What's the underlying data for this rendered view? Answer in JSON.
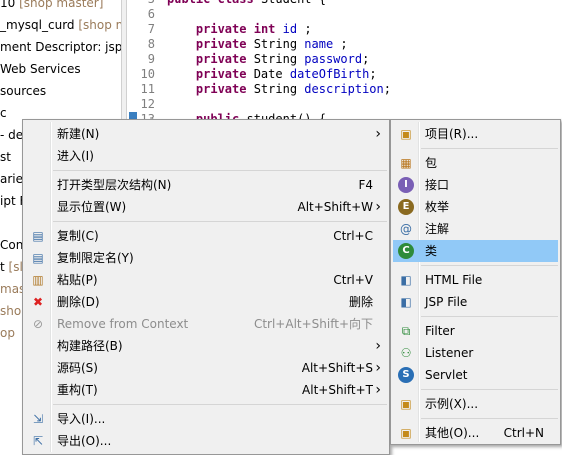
{
  "explorer": {
    "rows": [
      {
        "text": "10",
        "muted": " [shop master]"
      },
      {
        "text": "_mysql_curd",
        "muted": " [shop m"
      },
      {
        "text": "ment Descriptor: jsp_",
        "muted": ""
      },
      {
        "text": " Web Services",
        "muted": ""
      },
      {
        "text": "sources",
        "muted": ""
      },
      {
        "text": "c",
        "muted": ""
      },
      {
        "text": "- demo",
        "muted": ""
      },
      {
        "text": "st",
        "muted": ""
      },
      {
        "text": "aries",
        "muted": ""
      },
      {
        "text": "ipt F",
        "muted": ""
      },
      {
        "text": "",
        "muted": ""
      },
      {
        "text": "Cont",
        "muted": ""
      },
      {
        "text": "t",
        "muted": " [sl"
      },
      {
        "text": "",
        "muted": "mas"
      },
      {
        "text": "",
        "muted": "sho"
      },
      {
        "text": "",
        "muted": "op"
      }
    ]
  },
  "editor": {
    "lines": [
      {
        "n": "5",
        "code": "public class Student {"
      },
      {
        "n": "6",
        "code": ""
      },
      {
        "n": "7",
        "code": "    private int id ;"
      },
      {
        "n": "8",
        "code": "    private String name ;"
      },
      {
        "n": "9",
        "code": "    private String password;"
      },
      {
        "n": "10",
        "code": "    private Date dateOfBirth;"
      },
      {
        "n": "11",
        "code": "    private String description;"
      },
      {
        "n": "12",
        "code": ""
      },
      {
        "n": "13",
        "code": "    public student() {"
      }
    ]
  },
  "main_menu": {
    "items": [
      {
        "icon": "",
        "label": "新建(N)",
        "shortcut": "",
        "arrow": true
      },
      {
        "icon": "",
        "label": "进入(I)",
        "shortcut": ""
      },
      {
        "sep": true
      },
      {
        "icon": "",
        "label": "打开类型层次结构(N)",
        "shortcut": "F4"
      },
      {
        "icon": "",
        "label": "显示位置(W)",
        "shortcut": "Alt+Shift+W",
        "arrow": true
      },
      {
        "sep": true
      },
      {
        "icon": "copy-icon",
        "label": "复制(C)",
        "shortcut": "Ctrl+C"
      },
      {
        "icon": "copy-qualified-icon",
        "label": "复制限定名(Y)",
        "shortcut": ""
      },
      {
        "icon": "paste-icon",
        "label": "粘贴(P)",
        "shortcut": "Ctrl+V"
      },
      {
        "icon": "delete-icon",
        "label": "删除(D)",
        "shortcut": "删除"
      },
      {
        "icon": "remove-context-icon",
        "label": "Remove from Context",
        "shortcut": "Ctrl+Alt+Shift+向下",
        "disabled": true
      },
      {
        "icon": "",
        "label": "构建路径(B)",
        "shortcut": "",
        "arrow": true
      },
      {
        "icon": "",
        "label": "源码(S)",
        "shortcut": "Alt+Shift+S",
        "arrow": true
      },
      {
        "icon": "",
        "label": "重构(T)",
        "shortcut": "Alt+Shift+T",
        "arrow": true
      },
      {
        "sep": true
      },
      {
        "icon": "import-icon",
        "label": "导入(I)...",
        "shortcut": ""
      },
      {
        "icon": "export-icon",
        "label": "导出(O)...",
        "shortcut": ""
      }
    ]
  },
  "sub_menu": {
    "items": [
      {
        "icon": "project-icon",
        "label": "项目(R)...",
        "shortcut": ""
      },
      {
        "sep": true
      },
      {
        "icon": "package-icon",
        "label": "包",
        "shortcut": ""
      },
      {
        "icon": "interface-icon",
        "label": "接口",
        "shortcut": ""
      },
      {
        "icon": "enum-icon",
        "label": "枚举",
        "shortcut": ""
      },
      {
        "icon": "annotation-icon",
        "label": "注解",
        "shortcut": ""
      },
      {
        "icon": "class-icon",
        "label": "类",
        "shortcut": "",
        "highlight": true
      },
      {
        "sep": true
      },
      {
        "icon": "html-file-icon",
        "label": "HTML File",
        "shortcut": ""
      },
      {
        "icon": "jsp-file-icon",
        "label": "JSP File",
        "shortcut": ""
      },
      {
        "sep": true
      },
      {
        "icon": "filter-icon",
        "label": "Filter",
        "shortcut": ""
      },
      {
        "icon": "listener-icon",
        "label": "Listener",
        "shortcut": ""
      },
      {
        "icon": "servlet-icon",
        "label": "Servlet",
        "shortcut": ""
      },
      {
        "sep": true
      },
      {
        "icon": "example-icon",
        "label": "示例(X)...",
        "shortcut": ""
      },
      {
        "sep": true
      },
      {
        "icon": "other-icon",
        "label": "其他(O)...",
        "shortcut": "Ctrl+N"
      }
    ]
  },
  "colors": {
    "highlight": "#91c9f7",
    "menu_bg": "#f0f0f0",
    "keyword": "#7f0055",
    "field": "#0000c0"
  }
}
